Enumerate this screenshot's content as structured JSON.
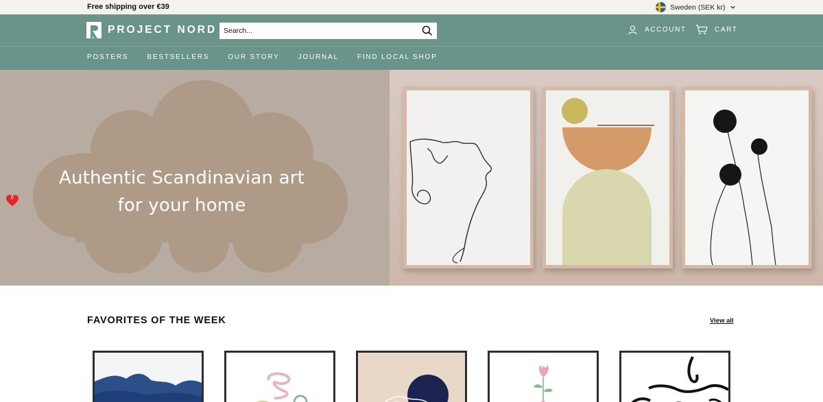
{
  "announcement": {
    "shipping_text": "Free shipping over €39",
    "locale_label": "Sweden (SEK kr)"
  },
  "header": {
    "logo_text": "PROJECT NORD",
    "search_placeholder": "Search...",
    "account_label": "ACCOUNT",
    "cart_label": "CART"
  },
  "nav": {
    "items": [
      "POSTERS",
      "BESTSELLERS",
      "OUR STORY",
      "JOURNAL",
      "FIND LOCAL SHOP"
    ]
  },
  "hero": {
    "headline_line1": "Authentic Scandinavian art",
    "headline_line2": "for your home"
  },
  "wishlist": {
    "count": "0"
  },
  "favorites": {
    "title": "FAVORITES OF THE WEEK",
    "view_all_label": "View all"
  },
  "colors": {
    "header_bg": "#6a938a",
    "announcement_bg": "#f3f2ee",
    "hero_bg": "#b8aba1",
    "cloud": "#ae9a87",
    "wishlist_heart": "#e8242b"
  },
  "icons": {
    "account": "user-icon",
    "cart": "cart-icon",
    "search": "search-icon",
    "locale_flag": "sweden-flag-icon",
    "locale_chevron": "chevron-down-icon",
    "wishlist": "heart-icon"
  }
}
